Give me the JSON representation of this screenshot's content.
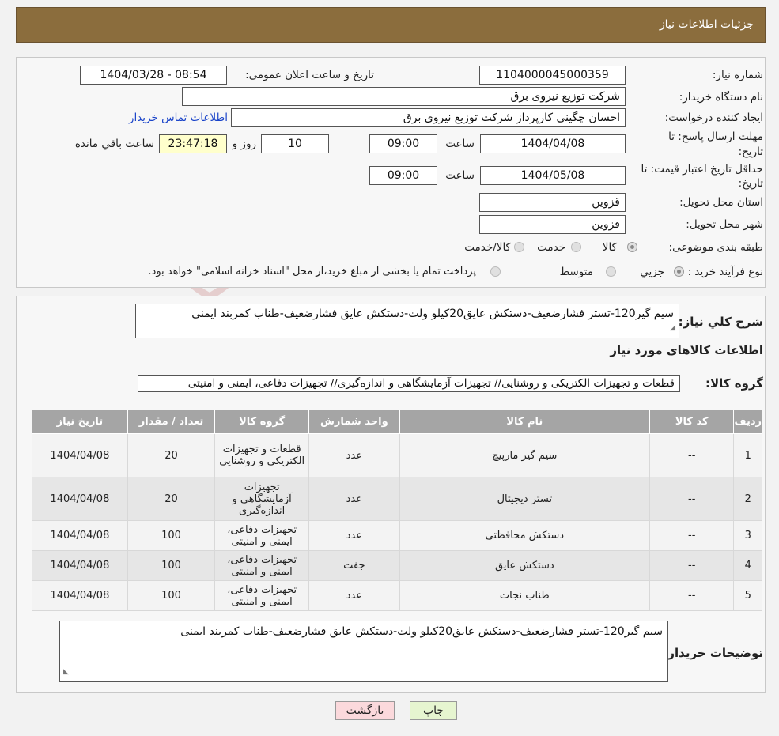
{
  "header": {
    "title": "جزئیات اطلاعات نیاز"
  },
  "form": {
    "need_number_label": "شماره نیاز:",
    "need_number": "1104000045000359",
    "announce_label": "تاریخ و ساعت اعلان عمومی:",
    "announce_value": "1404/03/28 - 08:54",
    "buyer_org_label": "نام دستگاه خریدار:",
    "buyer_org": "شرکت توزیع نیروی برق",
    "creator_label": "ایجاد کننده درخواست:",
    "creator": "احسان چگینی کارپرداز شرکت توزیع نیروی برق",
    "contact_link": "اطلاعات تماس خریدار",
    "deadline_label_1": "مهلت ارسال پاسخ: تا",
    "deadline_label_2": "تاریخ:",
    "deadline_date": "1404/04/08",
    "time_label": "ساعت",
    "deadline_time": "09:00",
    "days_value": "10",
    "days_label": "روز و",
    "remaining_time": "23:47:18",
    "remaining_label": "ساعت باقي مانده",
    "validity_label_1": "حداقل تاریخ اعتبار قیمت: تا",
    "validity_label_2": "تاریخ:",
    "validity_date": "1404/05/08",
    "validity_time": "09:00",
    "province_label": "استان محل تحویل:",
    "province": "قزوین",
    "city_label": "شهر محل تحویل:",
    "city": "قزوین",
    "category_label": "طبقه بندی موضوعی:",
    "category_options": [
      "کالا",
      "خدمت",
      "کالا/خدمت"
    ],
    "process_label": "نوع فرآیند خرید :",
    "process_options": [
      "جزیي",
      "متوسط"
    ],
    "payment_note": "پرداخت تمام یا بخشی از مبلغ خرید،از محل \"اسناد خزانه اسلامی\" خواهد بود."
  },
  "summary": {
    "label": "شرح کلي نياز:",
    "text": "سیم گیر120-تستر فشارضعیف-دستکش عایق20کیلو ولت-دستکش عایق فشارضعیف-طناب کمربند ایمنی",
    "items_title": "اطلاعات کالاهای مورد نیاز",
    "group_label": "گروه کالا:",
    "group_value": "قطعات و تجهیزات الکتریکی و روشنایی// تجهیزات آزمایشگاهی و اندازه‌گیری// تجهیزات دفاعی، ایمنی و امنیتی"
  },
  "table": {
    "headers": [
      "ردیف",
      "کد کالا",
      "نام کالا",
      "واحد شمارش",
      "گروه کالا",
      "تعداد / مقدار",
      "تاریخ نیاز"
    ],
    "rows": [
      [
        "1",
        "--",
        "سیم گیر مارپیچ",
        "عدد",
        "قطعات و تجهیزات الکتریکی و روشنایی",
        "20",
        "1404/04/08"
      ],
      [
        "2",
        "--",
        "تستر دیجیتال",
        "عدد",
        "تجهیزات آزمایشگاهی و اندازه‌گیری",
        "20",
        "1404/04/08"
      ],
      [
        "3",
        "--",
        "دستکش محافظتی",
        "عدد",
        "تجهیزات دفاعی، ایمنی و امنیتی",
        "100",
        "1404/04/08"
      ],
      [
        "4",
        "--",
        "دستکش عایق",
        "جفت",
        "تجهیزات دفاعی، ایمنی و امنیتی",
        "100",
        "1404/04/08"
      ],
      [
        "5",
        "--",
        "طناب نجات",
        "عدد",
        "تجهیزات دفاعی، ایمنی و امنیتی",
        "100",
        "1404/04/08"
      ]
    ]
  },
  "notes": {
    "label": "توضیحات خریدار:",
    "text": "سیم گیر120-تستر فشارضعیف-دستکش عایق20کیلو ولت-دستکش عایق فشارضعیف-طناب کمربند ایمنی"
  },
  "buttons": {
    "print": "چاپ",
    "back": "بازگشت"
  },
  "watermark": {
    "text": "AriaTender.neT"
  },
  "colors": {
    "header_bg": "#8b6d3d",
    "table_header_bg": "#a5a5a5",
    "print_btn": "#e6f5d0",
    "back_btn": "#fbd9dc",
    "link": "#1a44c9"
  }
}
